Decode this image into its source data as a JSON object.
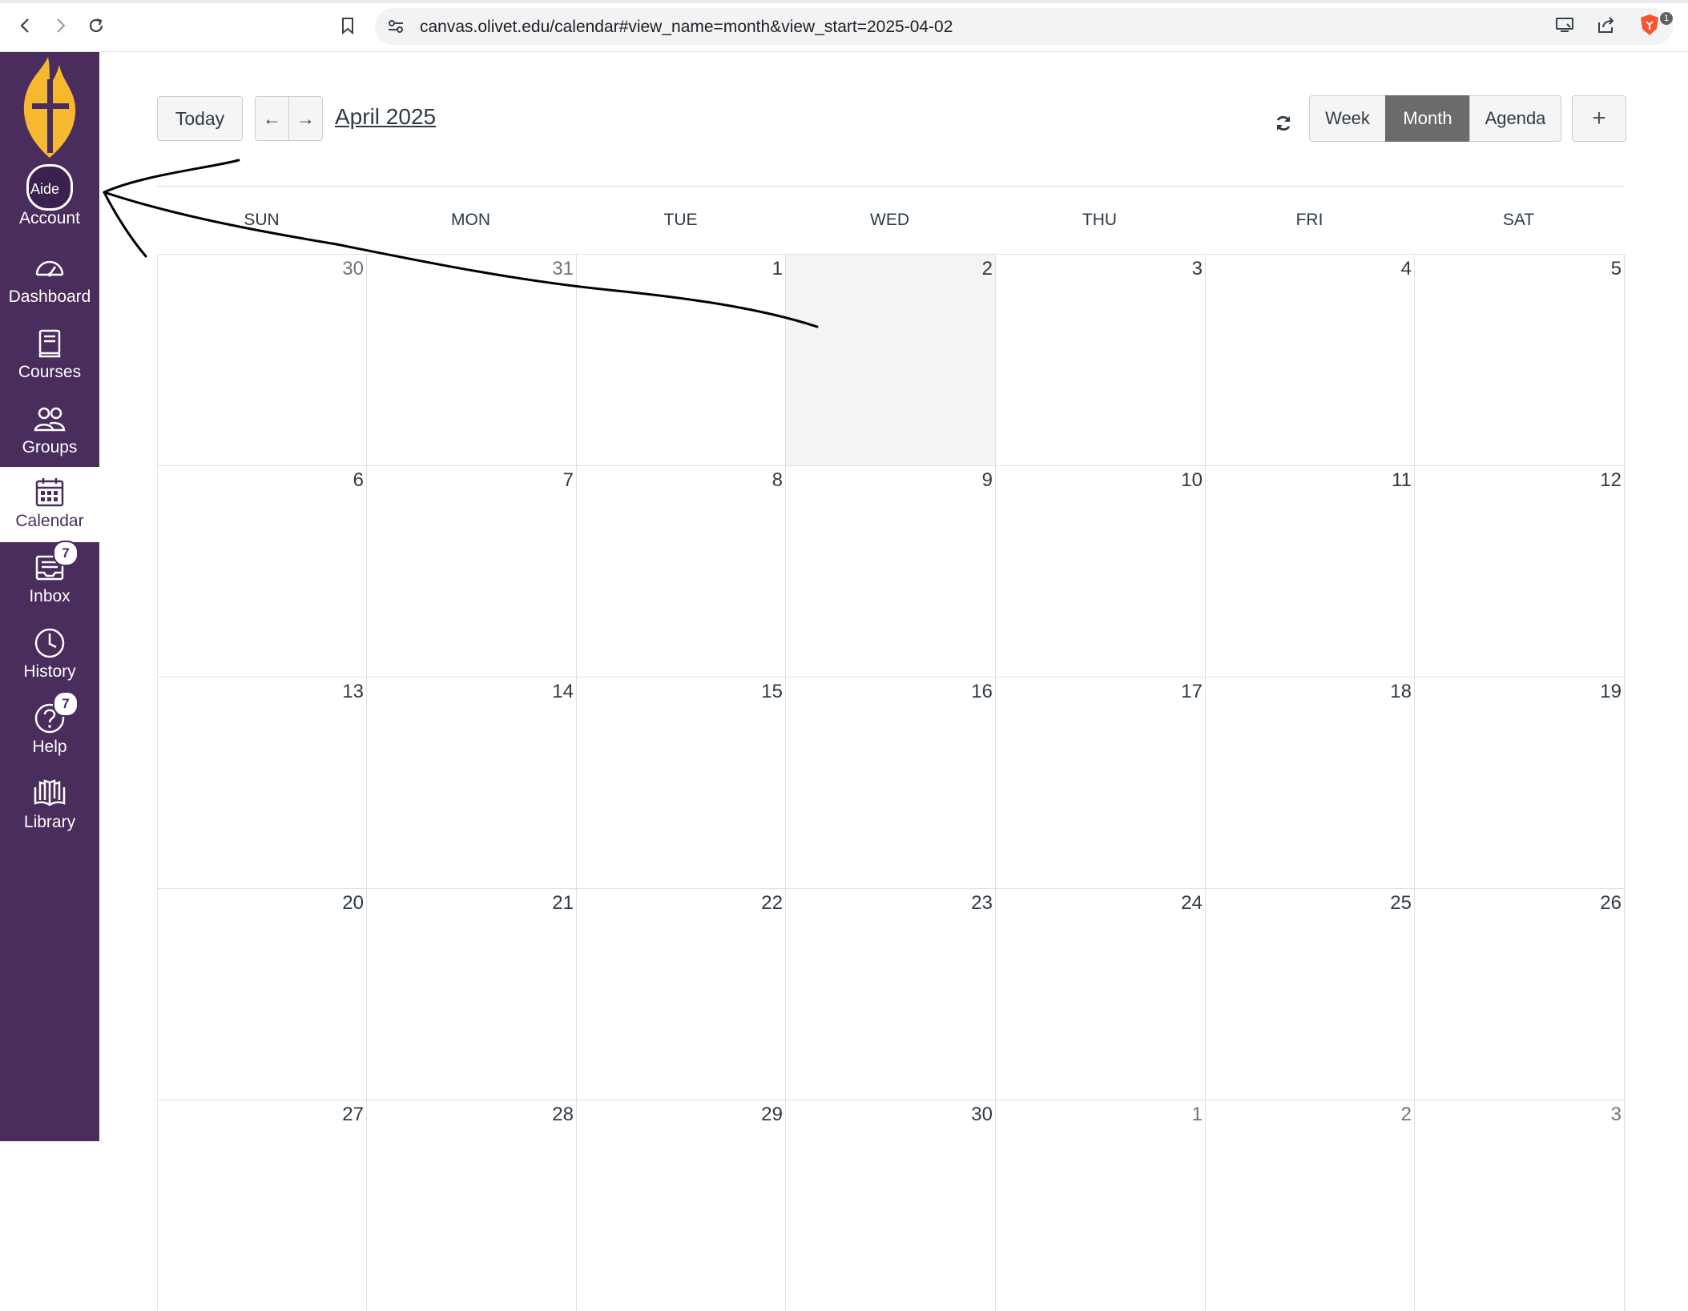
{
  "browser": {
    "url": "canvas.olivet.edu/calendar#view_name=month&view_start=2025-04-02",
    "extension_badge": "1",
    "icons": [
      "back-icon",
      "forward-icon",
      "reload-icon",
      "bookmark-icon",
      "site-settings-icon",
      "cast-icon",
      "share-icon",
      "brave-shield-icon"
    ]
  },
  "globalnav": {
    "accent_color": "#4a2c5d",
    "logo_colors": [
      "#f5b82e",
      "#4a2c5d"
    ],
    "account": {
      "label": "Account",
      "avatar_alt": "Aide"
    },
    "items": [
      {
        "label": "Dashboard",
        "icon": "dashboard-icon"
      },
      {
        "label": "Courses",
        "icon": "courses-icon"
      },
      {
        "label": "Groups",
        "icon": "groups-icon"
      },
      {
        "label": "Calendar",
        "icon": "calendar-icon",
        "active": true
      },
      {
        "label": "Inbox",
        "icon": "inbox-icon",
        "badge": "7"
      },
      {
        "label": "History",
        "icon": "history-icon"
      },
      {
        "label": "Help",
        "icon": "help-icon",
        "badge": "7"
      },
      {
        "label": "Library",
        "icon": "library-icon"
      }
    ]
  },
  "calendar": {
    "today_label": "Today",
    "prev_label": "←",
    "next_label": "→",
    "month_title": "April 2025",
    "refresh_icon": "refresh-icon",
    "views": [
      {
        "label": "Week",
        "active": false
      },
      {
        "label": "Month",
        "active": true
      },
      {
        "label": "Agenda",
        "active": false
      }
    ],
    "add_label": "+",
    "weekdays": [
      "SUN",
      "MON",
      "TUE",
      "WED",
      "THU",
      "FRI",
      "SAT"
    ],
    "weeks": [
      [
        {
          "d": "30",
          "other": true
        },
        {
          "d": "31",
          "other": true
        },
        {
          "d": "1"
        },
        {
          "d": "2",
          "today": true
        },
        {
          "d": "3"
        },
        {
          "d": "4"
        },
        {
          "d": "5"
        }
      ],
      [
        {
          "d": "6"
        },
        {
          "d": "7"
        },
        {
          "d": "8"
        },
        {
          "d": "9"
        },
        {
          "d": "10"
        },
        {
          "d": "11"
        },
        {
          "d": "12"
        }
      ],
      [
        {
          "d": "13"
        },
        {
          "d": "14"
        },
        {
          "d": "15"
        },
        {
          "d": "16"
        },
        {
          "d": "17"
        },
        {
          "d": "18"
        },
        {
          "d": "19"
        }
      ],
      [
        {
          "d": "20"
        },
        {
          "d": "21"
        },
        {
          "d": "22"
        },
        {
          "d": "23"
        },
        {
          "d": "24"
        },
        {
          "d": "25"
        },
        {
          "d": "26"
        }
      ],
      [
        {
          "d": "27"
        },
        {
          "d": "28"
        },
        {
          "d": "29"
        },
        {
          "d": "30"
        },
        {
          "d": "1",
          "other": true
        },
        {
          "d": "2",
          "other": true
        },
        {
          "d": "3",
          "other": true
        }
      ]
    ]
  },
  "annotation": {
    "type": "hand-drawn arrow",
    "points_to": "Account",
    "color": "#000000"
  }
}
